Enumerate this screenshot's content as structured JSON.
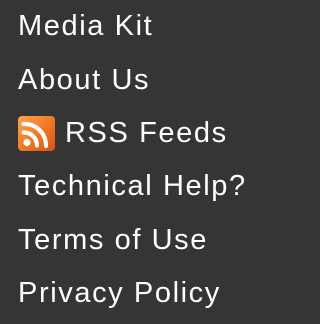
{
  "menu": {
    "items": [
      {
        "label": "Media Kit"
      },
      {
        "label": "About Us"
      },
      {
        "label": "RSS Feeds",
        "icon": "rss-icon"
      },
      {
        "label": "Technical Help?"
      },
      {
        "label": "Terms of Use"
      },
      {
        "label": "Privacy Policy"
      }
    ]
  },
  "colors": {
    "background": "#353535",
    "text": "#ffffff",
    "rss_orange": "#f26f21"
  }
}
